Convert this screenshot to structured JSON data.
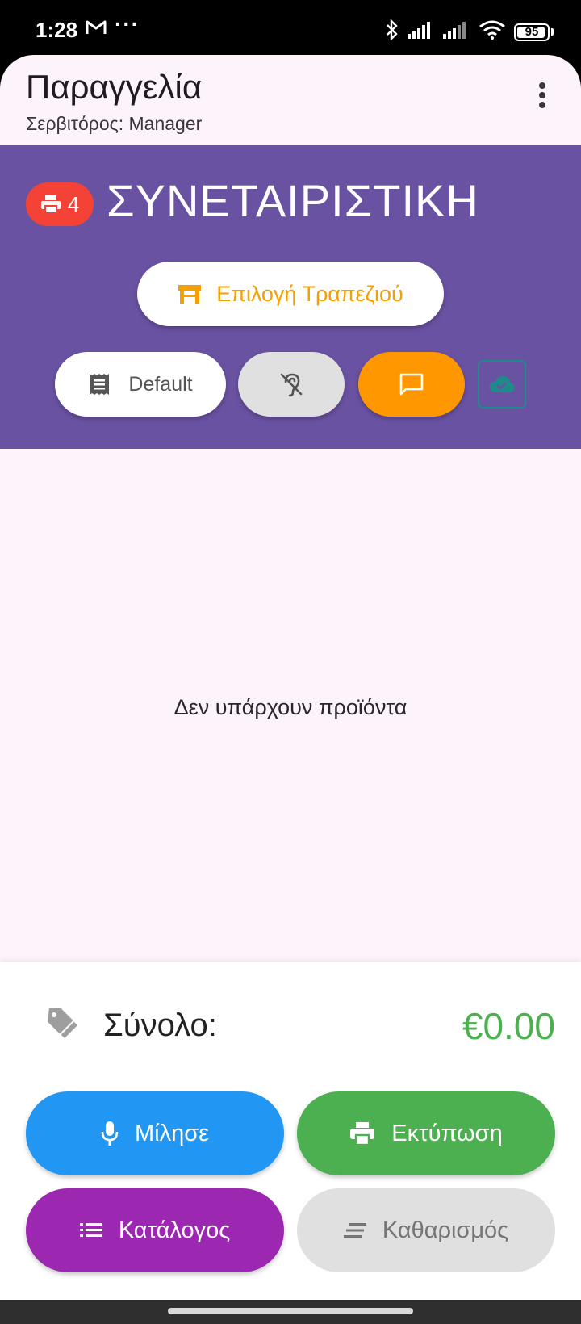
{
  "status_bar": {
    "time": "1:28",
    "battery": "95",
    "battery_level": 0.95,
    "icons": [
      "gmail-icon",
      "more-dots-icon",
      "bluetooth-icon",
      "signal-icon",
      "signal-icon",
      "wifi-icon",
      "battery-icon"
    ],
    "dots": "···"
  },
  "app_bar": {
    "title": "Παραγγελία",
    "subtitle": "Σερβιτόρος: Manager"
  },
  "header": {
    "print_count": "4",
    "store_name": "ΣΥΝΕΤΑΙΡΙΣΤΙΚΗ",
    "table_button": "Επιλογή Τραπεζιού",
    "price_list": "Default"
  },
  "main": {
    "empty_message": "Δεν υπάρχουν προϊόντα"
  },
  "summary": {
    "total_label": "Σύνολο:",
    "total_value": "€0.00"
  },
  "actions": {
    "speak": "Μίλησε",
    "print": "Εκτύπωση",
    "catalog": "Κατάλογος",
    "clear": "Καθαρισμός"
  },
  "colors": {
    "header_bg": "#6a52a3",
    "badge_red": "#f44336",
    "accent_orange": "#ff9800",
    "total_green": "#4caf50",
    "speak_blue": "#2196f3",
    "catalog_purple": "#9c27b0",
    "clear_gray": "#e0e0e0"
  }
}
